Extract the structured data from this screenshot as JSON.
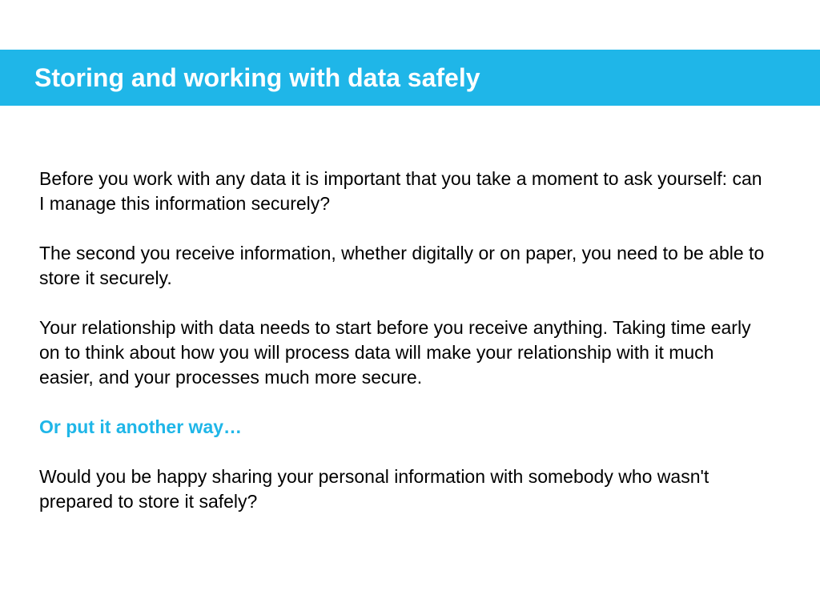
{
  "header": {
    "title": "Storing and working with data safely"
  },
  "content": {
    "para1": "Before you work with any data it is important that you take a moment to ask yourself: can I manage this information securely?",
    "para2": "The second you receive information, whether digitally or on paper, you need to be able to store it securely.",
    "para3": "Your relationship with data needs to start before you receive anything. Taking time early on to think about how you will process data will make your relationship with it much easier, and your processes much more secure.",
    "highlight": "Or put it another way…",
    "para4": "Would you be happy sharing your personal information with somebody who wasn't prepared to store it safely?"
  },
  "colors": {
    "accent": "#1fb6e8"
  }
}
